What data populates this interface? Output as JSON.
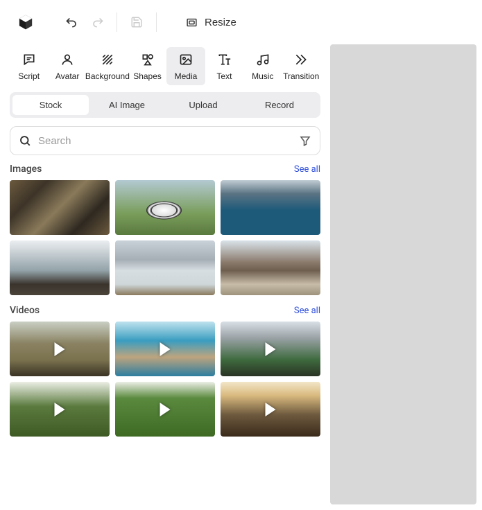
{
  "topbar": {
    "resize_label": "Resize"
  },
  "tabs": [
    {
      "label": "Script"
    },
    {
      "label": "Avatar"
    },
    {
      "label": "Background"
    },
    {
      "label": "Shapes"
    },
    {
      "label": "Media"
    },
    {
      "label": "Text"
    },
    {
      "label": "Music"
    },
    {
      "label": "Transition"
    }
  ],
  "segments": [
    {
      "label": "Stock"
    },
    {
      "label": "AI Image"
    },
    {
      "label": "Upload"
    },
    {
      "label": "Record"
    }
  ],
  "search": {
    "placeholder": "Search"
  },
  "sections": {
    "images": {
      "title": "Images",
      "see_all": "See all"
    },
    "videos": {
      "title": "Videos",
      "see_all": "See all"
    }
  }
}
